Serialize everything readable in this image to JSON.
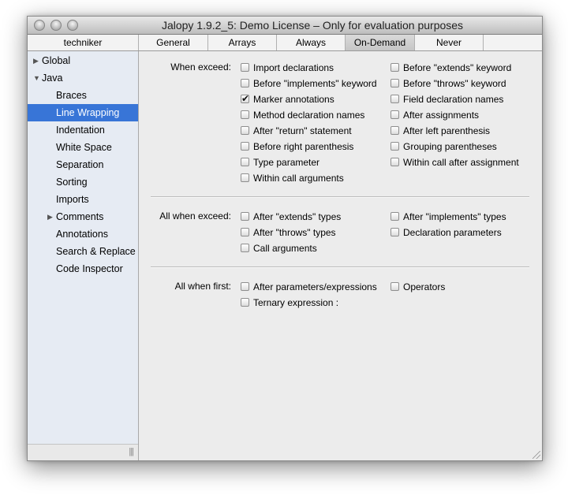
{
  "window": {
    "title": "Jalopy 1.9.2_5:  Demo License – Only for evaluation purposes"
  },
  "tabs": [
    {
      "label": "techniker",
      "active": false
    },
    {
      "label": "General",
      "active": false
    },
    {
      "label": "Arrays",
      "active": false
    },
    {
      "label": "Always",
      "active": false
    },
    {
      "label": "On-Demand",
      "active": true
    },
    {
      "label": "Never",
      "active": false
    }
  ],
  "sidebar": {
    "items": [
      {
        "label": "Global",
        "expander": "collapsed",
        "selected": false
      },
      {
        "label": "Java",
        "expander": "expanded",
        "selected": false
      },
      {
        "label": "Braces",
        "selected": false
      },
      {
        "label": "Line Wrapping",
        "selected": true
      },
      {
        "label": "Indentation",
        "selected": false
      },
      {
        "label": "White Space",
        "selected": false
      },
      {
        "label": "Separation",
        "selected": false
      },
      {
        "label": "Sorting",
        "selected": false
      },
      {
        "label": "Imports",
        "selected": false
      },
      {
        "label": "Comments",
        "expander": "collapsed",
        "selected": false
      },
      {
        "label": "Annotations",
        "selected": false
      },
      {
        "label": "Search & Replace",
        "selected": false
      },
      {
        "label": "Code Inspector",
        "selected": false
      }
    ],
    "grip": "|||"
  },
  "sections": {
    "when_exceed": {
      "label": "When exceed:",
      "left": [
        {
          "label": "Import declarations",
          "checked": false
        },
        {
          "label": "Before \"implements\" keyword",
          "checked": false
        },
        {
          "label": "Marker annotations",
          "checked": true
        },
        {
          "label": "Method declaration names",
          "checked": false
        },
        {
          "label": "After \"return\" statement",
          "checked": false
        },
        {
          "label": "Before right parenthesis",
          "checked": false
        },
        {
          "label": "Type parameter",
          "checked": false
        },
        {
          "label": "Within call arguments",
          "checked": false
        }
      ],
      "right": [
        {
          "label": "Before \"extends\" keyword",
          "checked": false
        },
        {
          "label": "Before \"throws\" keyword",
          "checked": false
        },
        {
          "label": "Field declaration names",
          "checked": false
        },
        {
          "label": "After assignments",
          "checked": false
        },
        {
          "label": "After left parenthesis",
          "checked": false
        },
        {
          "label": "Grouping parentheses",
          "checked": false
        },
        {
          "label": "Within call after assignment",
          "checked": false
        }
      ]
    },
    "all_when_exceed": {
      "label": "All when exceed:",
      "left": [
        {
          "label": "After \"extends\" types",
          "checked": false
        },
        {
          "label": "After \"throws\" types",
          "checked": false
        },
        {
          "label": "Call arguments",
          "checked": false
        }
      ],
      "right": [
        {
          "label": "After \"implements\" types",
          "checked": false
        },
        {
          "label": "Declaration parameters",
          "checked": false
        }
      ]
    },
    "all_when_first": {
      "label": "All when first:",
      "left": [
        {
          "label": "After parameters/expressions",
          "checked": false
        },
        {
          "label": "Ternary expression :",
          "checked": false
        }
      ],
      "right": [
        {
          "label": "Operators",
          "checked": false
        }
      ]
    }
  },
  "colors": {
    "selection": "#3875d7",
    "sidebar_bg": "#e6ebf3",
    "window_bg": "#ececec"
  }
}
